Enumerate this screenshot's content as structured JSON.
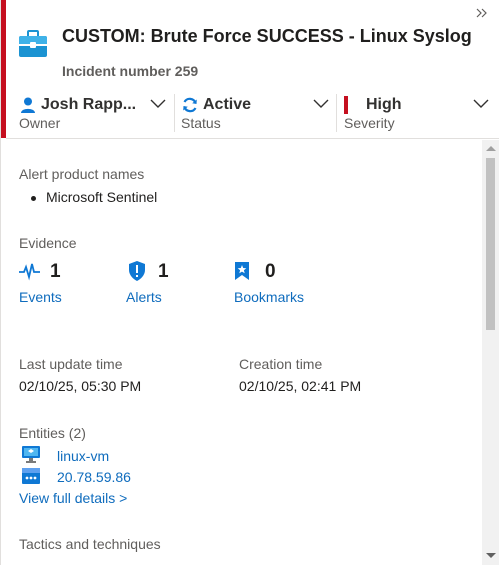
{
  "header": {
    "title": "CUSTOM: Brute Force SUCCESS - Linux Syslog",
    "incident_number": "Incident number 259",
    "icon": "briefcase-icon",
    "expand_icon": "double-chevron-right-icon"
  },
  "fields": {
    "owner": {
      "value": "Josh Rapp...",
      "label": "Owner",
      "icon": "person-icon"
    },
    "status": {
      "value": "Active",
      "label": "Status",
      "icon": "refresh-icon"
    },
    "severity": {
      "value": "High",
      "label": "Severity",
      "color": "#c50f1f"
    }
  },
  "alert_products": {
    "label": "Alert product names",
    "items": [
      "Microsoft Sentinel"
    ]
  },
  "evidence": {
    "label": "Evidence",
    "items": [
      {
        "count": "1",
        "label": "Events",
        "icon": "pulse-icon"
      },
      {
        "count": "1",
        "label": "Alerts",
        "icon": "shield-alert-icon"
      },
      {
        "count": "0",
        "label": "Bookmarks",
        "icon": "bookmark-icon"
      }
    ]
  },
  "times": {
    "last_update_label": "Last update time",
    "last_update_value": "02/10/25, 05:30 PM",
    "creation_label": "Creation time",
    "creation_value": "02/10/25, 02:41 PM"
  },
  "entities": {
    "label": "Entities (2)",
    "items": [
      {
        "name": "linux-vm",
        "icon": "virtual-machine-icon"
      },
      {
        "name": "20.78.59.86",
        "icon": "ip-address-icon"
      }
    ],
    "view_details": "View full details >"
  },
  "tactics": {
    "label": "Tactics and techniques"
  },
  "colors": {
    "accent": "#0f6cbd",
    "severity_high": "#c50f1f"
  }
}
